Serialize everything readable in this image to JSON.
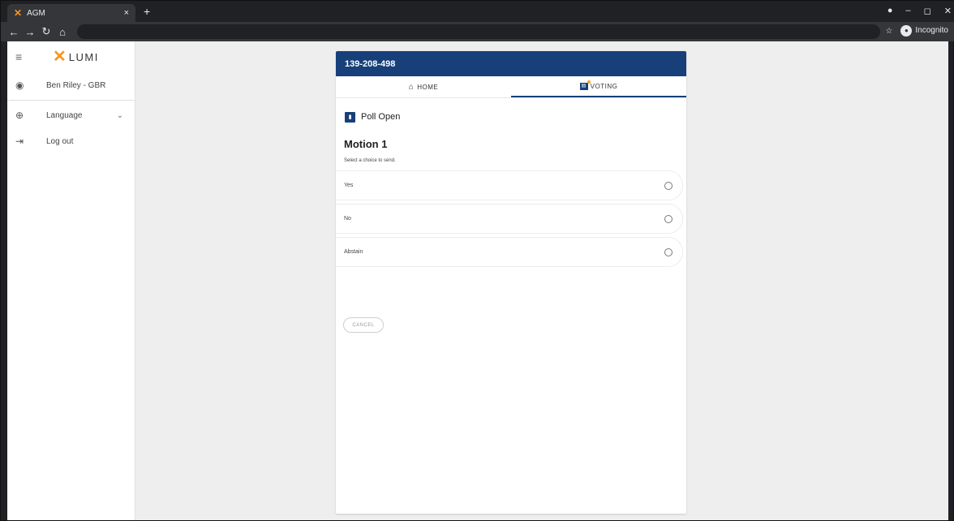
{
  "browser": {
    "tab_title": "AGM",
    "tab_close": "×",
    "new_tab": "+",
    "incognito_label": "Incognito",
    "window_controls": [
      "–",
      "◻",
      "✕"
    ]
  },
  "sidebar": {
    "logo_text": "LUMI",
    "items": [
      {
        "icon": "user-icon",
        "label": "Ben Riley - GBR"
      },
      {
        "icon": "globe-icon",
        "label": "Language"
      },
      {
        "icon": "logout-icon",
        "label": "Log out"
      }
    ]
  },
  "meeting": {
    "id": "139-208-498",
    "tabs": [
      {
        "label": "HOME",
        "active": false
      },
      {
        "label": "VOTING",
        "active": true
      }
    ],
    "poll_status": "Poll Open",
    "motion_title": "Motion 1",
    "instruction": "Select a choice to send.",
    "choices": [
      "Yes",
      "No",
      "Abstain"
    ],
    "cancel_label": "CANCEL"
  },
  "colors": {
    "header_blue": "#173f79",
    "lumi_orange": "#f7941d",
    "page_bg": "#eeeeee"
  }
}
